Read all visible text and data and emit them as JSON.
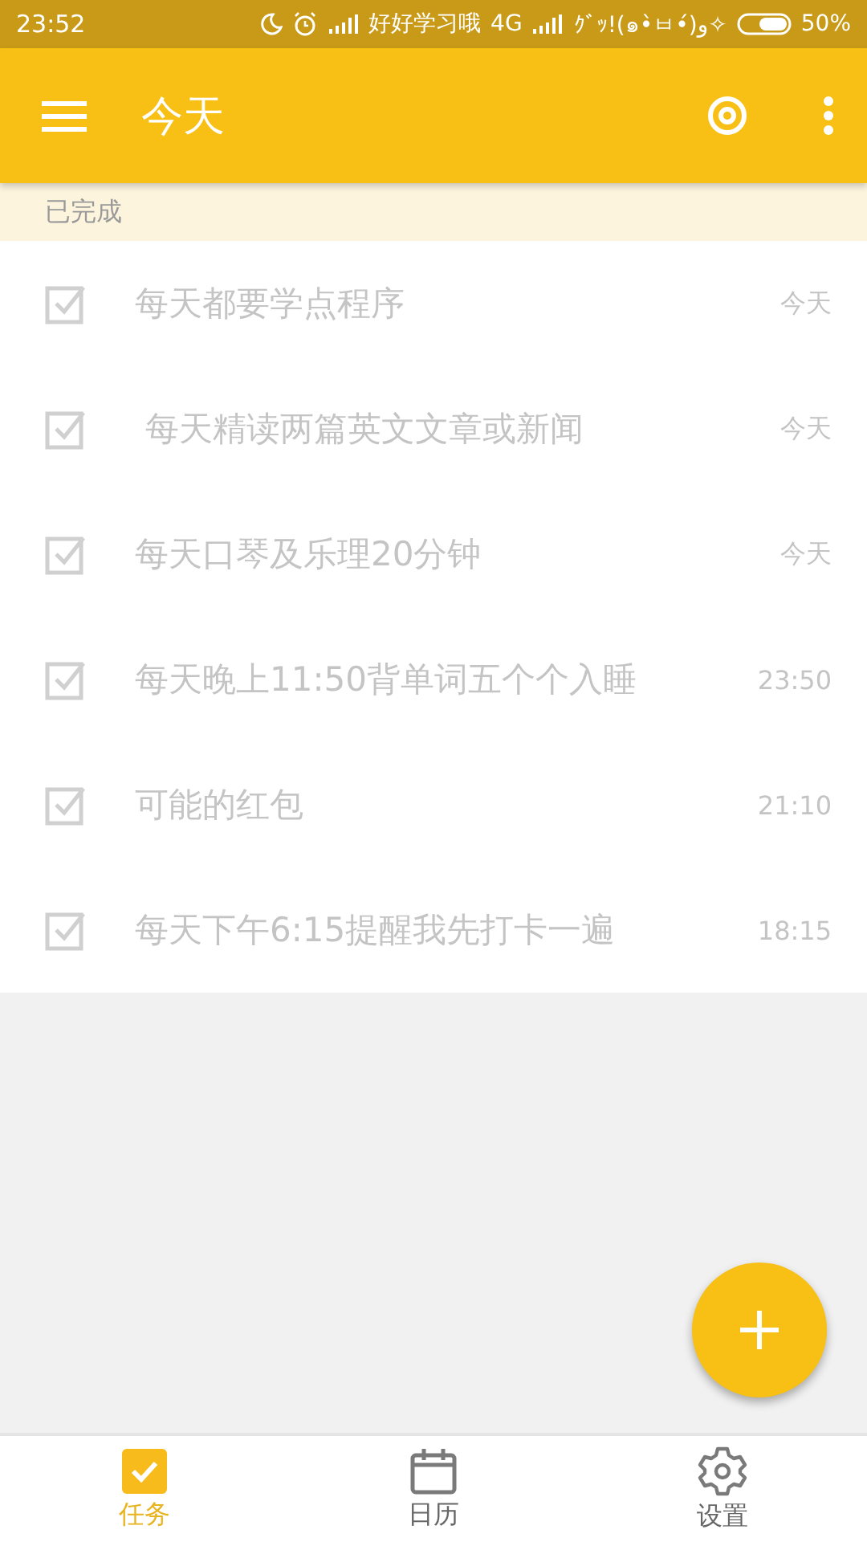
{
  "status_bar": {
    "time": "23:52",
    "carrier": "好好学习哦",
    "network": "4G",
    "carrier_2": "ｸﾞｯ!(๑•̀ㅂ•́)و✧",
    "battery": "50%"
  },
  "app_bar": {
    "title": "今天"
  },
  "section": {
    "title": "已完成"
  },
  "tasks": [
    {
      "title": "每天都要学点程序",
      "time": "今天",
      "checked": true
    },
    {
      "title": " 每天精读两篇英文文章或新闻",
      "time": "今天",
      "checked": true
    },
    {
      "title": "每天口琴及乐理20分钟",
      "time": "今天",
      "checked": true
    },
    {
      "title": "每天晚上11:50背单词五个个入睡",
      "time": "23:50",
      "checked": true
    },
    {
      "title": "可能的红包",
      "time": "21:10",
      "checked": true
    },
    {
      "title": "每天下午6:15提醒我先打卡一遍",
      "time": "18:15",
      "checked": true
    }
  ],
  "bottom_nav": [
    {
      "label": "任务",
      "kind": "tasks",
      "selected": true
    },
    {
      "label": "日历",
      "kind": "calendar",
      "selected": false
    },
    {
      "label": "设置",
      "kind": "settings",
      "selected": false
    }
  ]
}
